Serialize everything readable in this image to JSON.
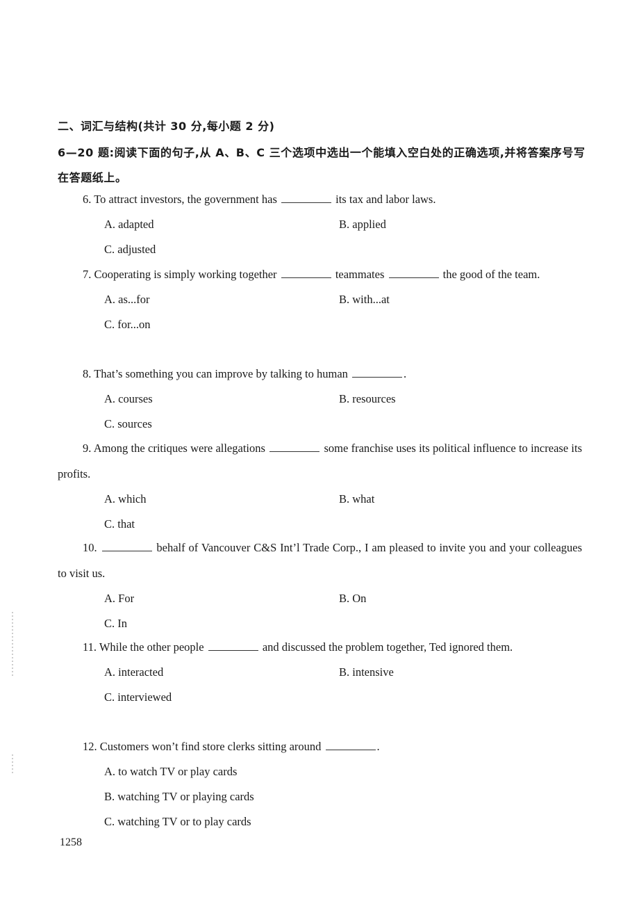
{
  "section": {
    "title": "二、词汇与结构(共计 30 分,每小题 2 分)",
    "instructions": "6—20 题:阅读下面的句子,从 A、B、C 三个选项中选出一个能填入空白处的正确选项,并将答案序号写在答题纸上。"
  },
  "questions": [
    {
      "number": "6.",
      "parts": [
        "To attract investors, the government has ",
        " its tax and labor laws."
      ],
      "options": {
        "A": "A. adapted",
        "B": "B. applied",
        "C": "C. adjusted"
      }
    },
    {
      "number": "7.",
      "parts": [
        "Cooperating is simply working together ",
        " teammates ",
        " the good of the team."
      ],
      "options": {
        "A": "A. as...for",
        "B": "B. with...at",
        "C": "C. for...on"
      }
    },
    {
      "number": "8.",
      "parts": [
        "That’s something you can improve by talking to human ",
        "."
      ],
      "options": {
        "A": "A. courses",
        "B": "B. resources",
        "C": "C. sources"
      }
    },
    {
      "number": "9.",
      "parts": [
        "Among the critiques were allegations ",
        " some franchise uses its political influence to increase its profits."
      ],
      "options": {
        "A": "A. which",
        "B": "B. what",
        "C": "C. that"
      }
    },
    {
      "number": "10.",
      "parts": [
        "",
        " behalf of Vancouver C&S Int’l Trade Corp., I am pleased to invite you and your colleagues to visit us."
      ],
      "options": {
        "A": "A. For",
        "B": "B. On",
        "C": "C. In"
      }
    },
    {
      "number": "11.",
      "parts": [
        "While the other people ",
        " and discussed the problem together, Ted ignored them."
      ],
      "options": {
        "A": "A. interacted",
        "B": "B. intensive",
        "C": "C. interviewed"
      }
    },
    {
      "number": "12.",
      "parts": [
        "Customers won’t find store clerks sitting around ",
        "."
      ],
      "options": {
        "A": "A. to watch TV or play cards",
        "B": "B. watching TV or playing cards",
        "C": "C. watching TV or to play cards"
      }
    }
  ],
  "page_number": "1258"
}
